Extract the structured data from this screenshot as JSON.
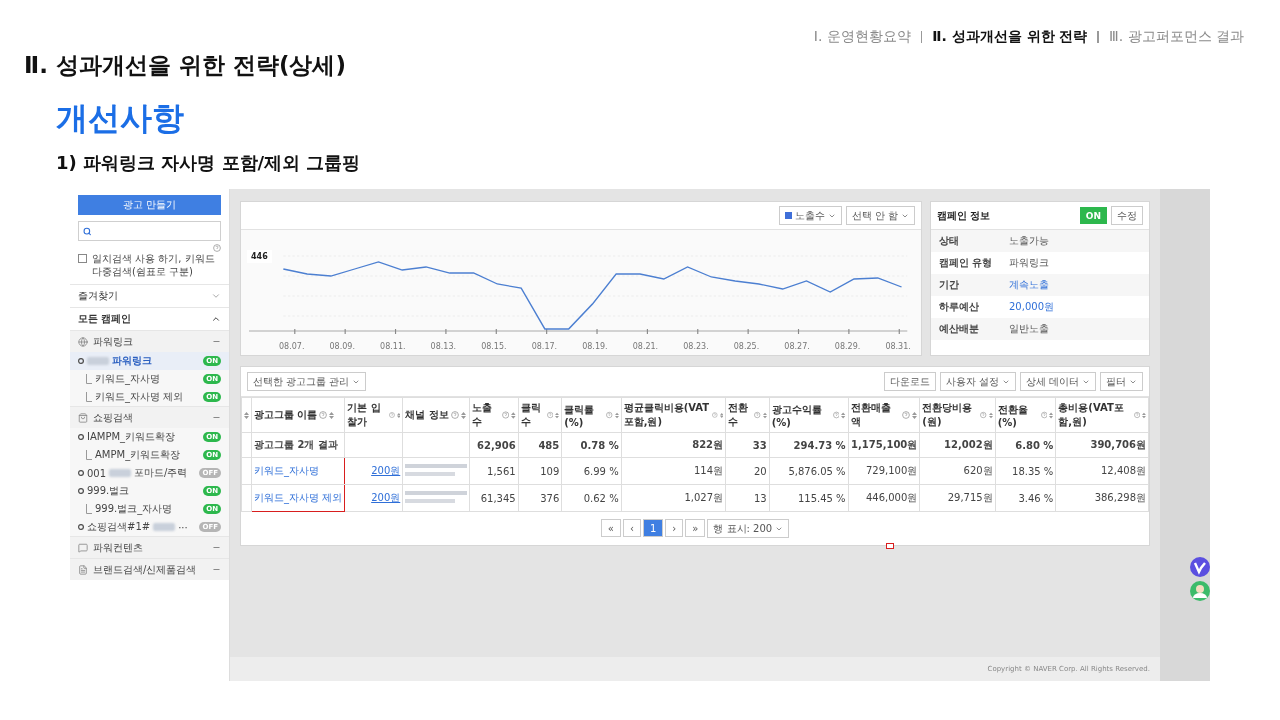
{
  "nav": [
    {
      "label": "Ⅰ. 운영현황요약",
      "selected": false
    },
    {
      "label": "Ⅱ. 성과개선을 위한 전략",
      "selected": true
    },
    {
      "label": "Ⅲ. 광고퍼포먼스 결과",
      "selected": false
    }
  ],
  "title": "Ⅱ. 성과개선을 위한 전략(상세)",
  "heading": "개선사항",
  "subheading": "1) 파워링크 자사명 포함/제외 그룹핑",
  "sidebar": {
    "create_button": "광고 만들기",
    "exact_match": {
      "label": "일치검색 사용 하기, 키워드 다중검색(쉼표로 구분)",
      "checked": false
    },
    "sections": [
      {
        "label": "즐겨찾기",
        "expanded": false
      },
      {
        "label": "모든 캠페인",
        "expanded": true
      }
    ],
    "campaign_types": [
      {
        "label": "파워링크",
        "campaigns": [
          {
            "label": "파워링크",
            "redacted": true,
            "badge": "ON",
            "on": true,
            "selected": true,
            "children": [
              {
                "label": "키워드_자사명",
                "badge": "ON",
                "on": true,
                "selected": false
              },
              {
                "label": "키워드_자사명 제외",
                "badge": "ON",
                "on": true,
                "selected": false
              }
            ]
          }
        ]
      },
      {
        "label": "쇼핑검색",
        "campaigns": [
          {
            "label": "IAMPM_키워드확장",
            "badge": "ON",
            "on": true,
            "selected": false,
            "children": [
              {
                "label": "AMPM_키워드확장",
                "badge": "ON",
                "on": true,
                "selected": false
              }
            ]
          },
          {
            "prefix": "001",
            "label": "포마드/주력",
            "redacted": true,
            "badge": "OFF",
            "on": false,
            "selected": false
          },
          {
            "label": "999.벌크",
            "badge": "ON",
            "on": true,
            "selected": false,
            "children": [
              {
                "label": "999.벌크_자사명",
                "badge": "ON",
                "on": true,
                "selected": false
              }
            ]
          },
          {
            "prefix": "쇼핑검색#1#",
            "label": "···",
            "redacted": true,
            "badge": "OFF",
            "on": false,
            "selected": false
          }
        ]
      },
      {
        "label": "파워컨텐츠"
      },
      {
        "label": "브랜드검색/신제품검색"
      }
    ]
  },
  "chart_panel": {
    "metric_dropdown": "노출수",
    "compare_dropdown": "선택 안 함",
    "point_label": "446",
    "x_labels": [
      "08.07.",
      "08.09.",
      "08.11.",
      "08.13.",
      "08.15.",
      "08.17.",
      "08.19.",
      "08.21.",
      "08.23.",
      "08.25.",
      "08.27.",
      "08.29.",
      "08.31."
    ]
  },
  "campaign_info": {
    "title": "캠페인 정보",
    "toggle": {
      "label": "ON",
      "on": true
    },
    "edit_button": "수정",
    "rows": [
      {
        "label": "상태",
        "value": "노출가능",
        "link": false
      },
      {
        "label": "캠페인 유형",
        "value": "파워링크",
        "link": false
      },
      {
        "label": "기간",
        "value": "계속노출",
        "link": true
      },
      {
        "label": "하루예산",
        "value": "20,000원",
        "link": true
      },
      {
        "label": "예산배분",
        "value": "일반노출",
        "link": false
      }
    ]
  },
  "table_panel": {
    "manage_dropdown": "선택한 광고그룹 관리",
    "download_button": "다운로드",
    "dropdowns": [
      "사용자 설정",
      "상세 데이터",
      "필터"
    ],
    "columns": [
      "광고그룹 이름",
      "기본 입찰가",
      "채널 정보",
      "노출수",
      "클릭수",
      "클릭률(%)",
      "평균클릭비용(VAT포함,원)",
      "전환수",
      "광고수익률(%)",
      "전환매출액",
      "전환당비용(원)",
      "전환율(%)",
      "총비용(VAT포함,원)"
    ],
    "rows": [
      {
        "kind": "summary",
        "name": "광고그룹 2개 결과",
        "values": [
          "62,906",
          "485",
          "0.78 %",
          "822원",
          "33",
          "294.73 %",
          "1,175,100원",
          "12,002원",
          "6.80 %",
          "390,706원"
        ]
      },
      {
        "kind": "data",
        "name": "키워드_자사명",
        "bid": "200원",
        "channel_blurred": true,
        "highlighted": true,
        "values": [
          "1,561",
          "109",
          "6.99 %",
          "114원",
          "20",
          "5,876.05 %",
          "729,100원",
          "620원",
          "18.35 %",
          "12,408원"
        ]
      },
      {
        "kind": "data",
        "name": "키워드_자사명 제외",
        "bid": "200원",
        "channel_blurred": true,
        "highlighted": true,
        "values": [
          "61,345",
          "376",
          "0.62 %",
          "1,027원",
          "13",
          "115.45 %",
          "446,000원",
          "29,715원",
          "3.46 %",
          "386,298원"
        ]
      }
    ],
    "pagination": {
      "first": "«",
      "prev": "‹",
      "pages": [
        {
          "label": "1",
          "selected": true
        }
      ],
      "next": "›",
      "last": "»",
      "rows_dropdown": "행 표시: 200"
    }
  },
  "footer": "Copyright © NAVER Corp. All Rights Reserved."
}
